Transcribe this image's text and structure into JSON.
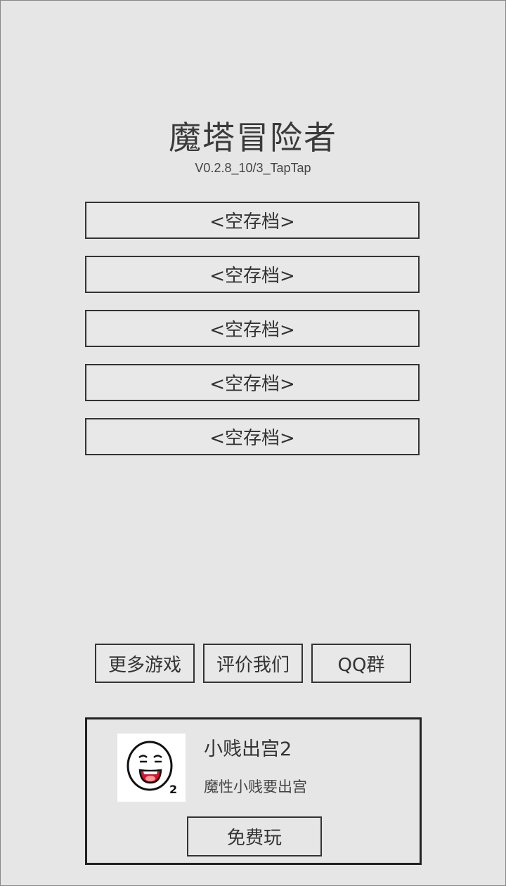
{
  "game": {
    "title": "魔塔冒险者",
    "version": "V0.2.8_10/3_TapTap"
  },
  "save_slots": [
    {
      "label": "<空存档>"
    },
    {
      "label": "<空存档>"
    },
    {
      "label": "<空存档>"
    },
    {
      "label": "<空存档>"
    },
    {
      "label": "<空存档>"
    }
  ],
  "buttons": {
    "more_games": "更多游戏",
    "rate_us": "评价我们",
    "qq_group": "QQ群"
  },
  "ad": {
    "icon": "smiley-face-icon",
    "icon_badge": "2",
    "title": "小贱出宫2",
    "description": "魔性小贱要出宫",
    "play_label": "免费玩"
  }
}
